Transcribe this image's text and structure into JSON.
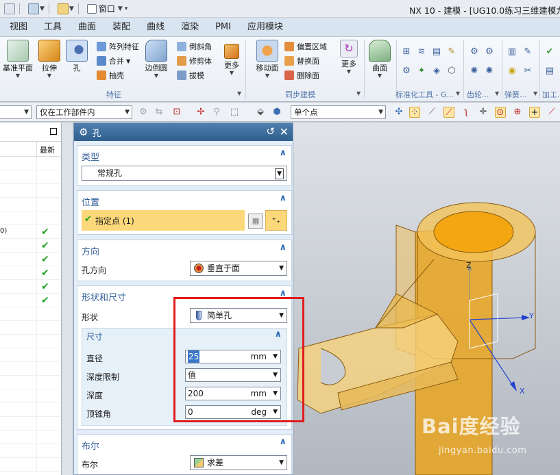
{
  "titlebar": {
    "window_label": "窗口",
    "app_title": "NX 10 - 建模 - [UG10.0练习三维建模九-"
  },
  "ribbon_tabs": [
    "视图",
    "工具",
    "曲面",
    "装配",
    "曲线",
    "渲染",
    "PMI",
    "应用模块"
  ],
  "ribbon": {
    "datum_plane": "基准平面",
    "extrude": "拉伸",
    "hole": "孔",
    "pattern_feature": "阵列特征",
    "unite": "合并",
    "shell": "抽壳",
    "edge_blend": "边倒圆",
    "chamfer": "倒斜角",
    "trim_body": "修剪体",
    "draft": "拔模",
    "more1": "更多",
    "feature_group": "特征",
    "move_face": "移动面",
    "offset_region": "偏置区域",
    "replace_face": "替换面",
    "delete_face": "删除面",
    "more2": "更多",
    "sync_group": "同步建模",
    "surface": "曲面",
    "std_tools_group": "标准化工具 - G...",
    "gear_group": "齿轮...",
    "spring_group": "弹簧...",
    "machining_group": "加工..."
  },
  "filterbar": {
    "scope_filter": "仅在工作部件内",
    "snap_point_filter": "单个点"
  },
  "navigator": {
    "column_latest": "最新",
    "row_fragment": "0)",
    "latest_checks": 6
  },
  "dialog": {
    "title": "孔",
    "type": {
      "header": "类型",
      "value": "常规孔"
    },
    "location": {
      "header": "位置",
      "specify_point": "指定点 (1)"
    },
    "direction": {
      "header": "方向",
      "label": "孔方向",
      "value": "垂直于面"
    },
    "form": {
      "header": "形状和尺寸",
      "shape_label": "形状",
      "shape_value": "简单孔",
      "dims_header": "尺寸",
      "diameter_label": "直径",
      "diameter_value": "25",
      "diameter_unit": "mm",
      "depth_limit_label": "深度限制",
      "depth_limit_value": "值",
      "depth_label": "深度",
      "depth_value": "200",
      "depth_unit": "mm",
      "tip_angle_label": "顶锥角",
      "tip_angle_value": "0",
      "tip_angle_unit": "deg"
    },
    "boolean": {
      "header": "布尔",
      "label": "布尔",
      "value": "求差"
    }
  },
  "viewport": {
    "axis_z": "Z",
    "axis_y": "Y",
    "axis_x": "X"
  },
  "watermark": {
    "brand": "Bai度经验",
    "url": "jingyan.baidu.com"
  },
  "colors": {
    "dialog_title_bar": "#3c6c9b",
    "section_title": "#2e5d97",
    "selected_row": "#fbd87a",
    "check_green": "#23a223",
    "highlight_frame": "#e01b1b",
    "model_orange": "#e8a21a"
  }
}
